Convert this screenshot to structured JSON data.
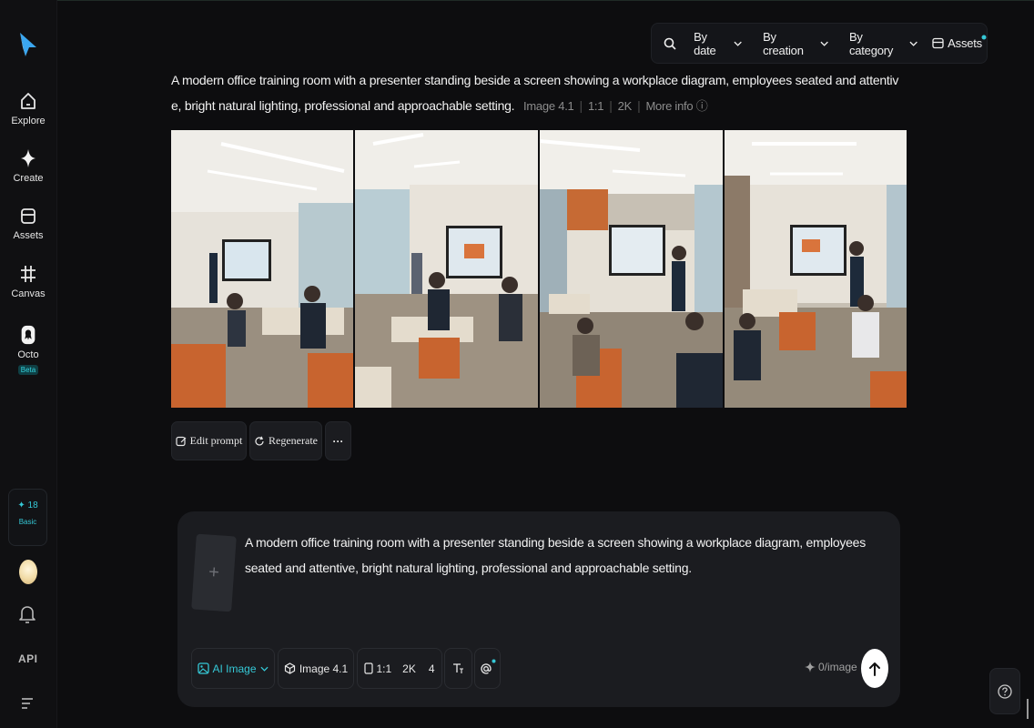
{
  "sidebar": {
    "items": [
      {
        "label": "Explore"
      },
      {
        "label": "Create"
      },
      {
        "label": "Assets"
      },
      {
        "label": "Canvas"
      },
      {
        "label": "Octo",
        "badge": "Beta"
      }
    ],
    "credits": {
      "count": "18",
      "plan": "Basic"
    },
    "api_label": "API"
  },
  "filters": {
    "by_date": "By date",
    "by_creation": "By creation",
    "by_category": "By category",
    "assets": "Assets"
  },
  "generation": {
    "prompt": "A modern office training room with a presenter standing beside a screen showing a workplace diagram, employees seated and attentive, bright natural lighting, professional and approachable setting.",
    "model": "Image 4.1",
    "ratio": "1:1",
    "resolution": "2K",
    "more_info": "More info"
  },
  "actions": {
    "edit_prompt": "Edit prompt",
    "regenerate": "Regenerate",
    "more": "···"
  },
  "composer": {
    "add_symbol": "+",
    "text": "A modern office training room with a presenter standing beside a screen showing a workplace diagram, employees seated and attentive, bright natural lighting, professional and approachable setting.",
    "mode": "AI Image",
    "model": "Image 4.1",
    "ratio": "1:1",
    "resolution": "2K",
    "count": "4",
    "cost": "0/image"
  },
  "colors": {
    "accent": "#35c8d6",
    "background": "#0d0d0f",
    "panel": "#1b1c20"
  }
}
